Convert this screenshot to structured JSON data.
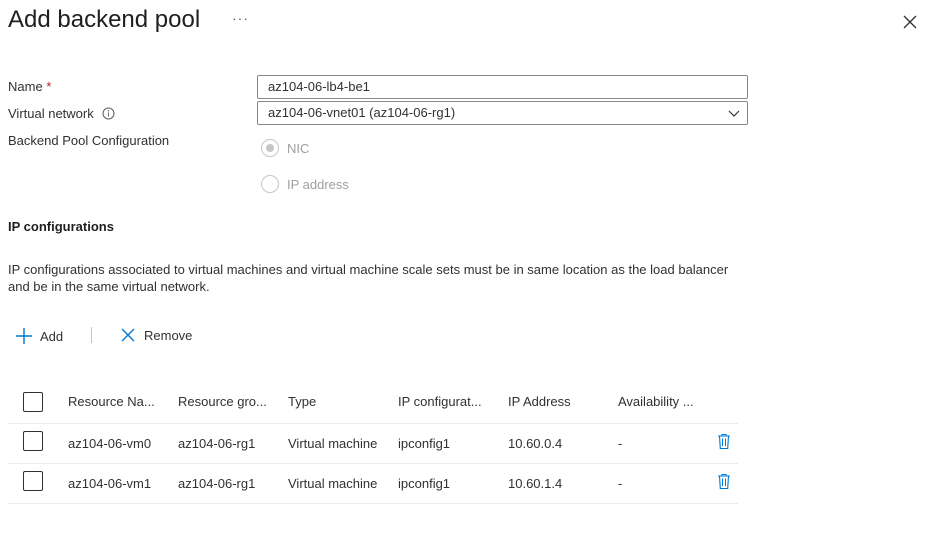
{
  "header": {
    "title": "Add backend pool",
    "more_label": "···"
  },
  "form": {
    "name_label": "Name",
    "name_required": "*",
    "name_value": "az104-06-lb4-be1",
    "vnet_label": "Virtual network",
    "vnet_value": "az104-06-vnet01 (az104-06-rg1)",
    "config_label": "Backend Pool Configuration",
    "options": [
      "NIC",
      "IP address"
    ],
    "selected_option": "NIC"
  },
  "ipconfig": {
    "heading": "IP configurations",
    "description": "IP configurations associated to virtual machines and virtual machine scale sets must be in same location as the load balancer and be in the same virtual network.",
    "add_label": "Add",
    "remove_label": "Remove"
  },
  "table": {
    "columns": [
      "Resource Na...",
      "Resource gro...",
      "Type",
      "IP configurat...",
      "IP Address",
      "Availability ..."
    ],
    "rows": [
      [
        "az104-06-vm0",
        "az104-06-rg1",
        "Virtual machine",
        "ipconfig1",
        "10.60.0.4",
        "-"
      ],
      [
        "az104-06-vm1",
        "az104-06-rg1",
        "Virtual machine",
        "ipconfig1",
        "10.60.1.4",
        "-"
      ]
    ]
  },
  "colors": {
    "accent": "#0078d4",
    "required": "#a4262c",
    "text": "#323130"
  },
  "icons": [
    "close-icon",
    "info-icon",
    "chevron-down-icon",
    "add-icon",
    "remove-icon",
    "delete-icon"
  ]
}
